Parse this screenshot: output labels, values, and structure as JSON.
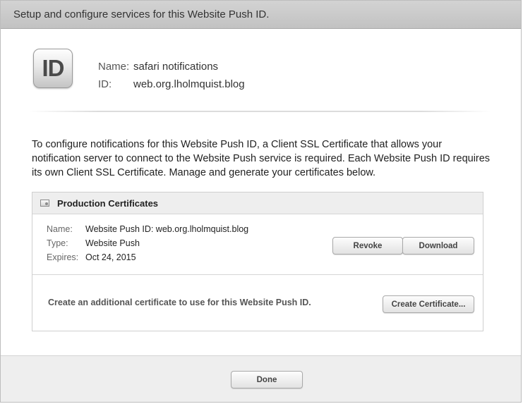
{
  "header": {
    "title": "Setup and configure services for this Website Push ID."
  },
  "identity": {
    "icon_text": "ID",
    "name_label": "Name:",
    "name_value": "safari notifications",
    "id_label": "ID:",
    "id_value": "web.org.lholmquist.blog"
  },
  "description": "To configure notifications for this Website Push ID, a Client SSL Certificate that allows your notification server to connect to the Website Push service is required. Each Website Push ID requires its own Client SSL Certificate. Manage and generate your certificates below.",
  "certificates": {
    "section_title": "Production Certificates",
    "certificate": {
      "name_label": "Name:",
      "name_value": "Website Push ID: web.org.lholmquist.blog",
      "type_label": "Type:",
      "type_value": "Website Push",
      "expires_label": "Expires:",
      "expires_value": "Oct 24, 2015"
    },
    "revoke_label": "Revoke",
    "download_label": "Download",
    "add_text": "Create an additional certificate to use for this Website Push ID.",
    "create_label": "Create Certificate..."
  },
  "footer": {
    "done_label": "Done"
  }
}
